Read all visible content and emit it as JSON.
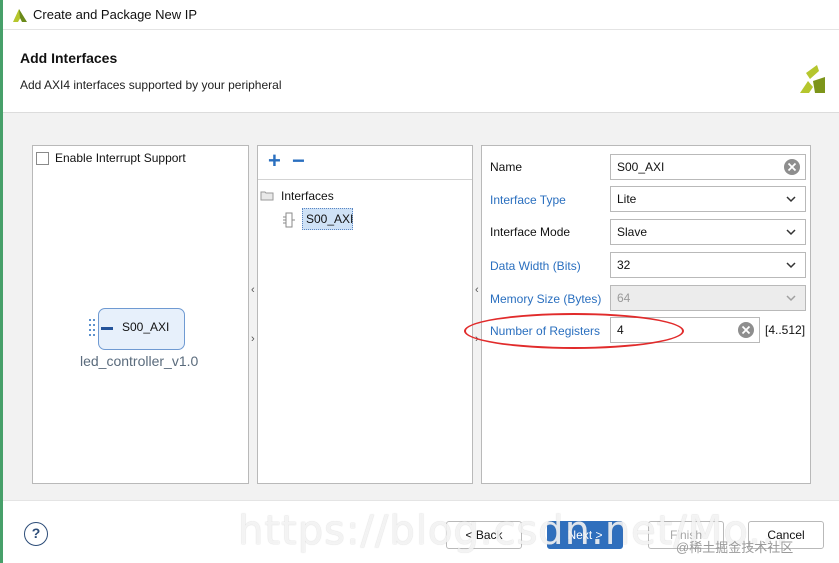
{
  "window": {
    "title": "Create and Package New IP"
  },
  "header": {
    "title": "Add Interfaces",
    "subtitle": "Add AXI4 interfaces supported by your peripheral"
  },
  "left_panel": {
    "interrupt_label": "Enable Interrupt Support",
    "interrupt_checked": false,
    "ip_port_label": "S00_AXI",
    "ip_name": "led_controller_v1.0"
  },
  "middle_panel": {
    "add_icon": "plus-icon",
    "remove_icon": "minus-icon",
    "tree_root": "Interfaces",
    "tree_items": [
      "S00_AXI"
    ]
  },
  "properties": {
    "name": {
      "label": "Name",
      "value": "S00_AXI"
    },
    "interface_type": {
      "label": "Interface Type",
      "value": "Lite"
    },
    "interface_mode": {
      "label": "Interface Mode",
      "value": "Slave"
    },
    "data_width": {
      "label": "Data Width (Bits)",
      "value": "32"
    },
    "memory_size": {
      "label": "Memory Size (Bytes)",
      "value": "64"
    },
    "num_registers": {
      "label": "Number of Registers",
      "value": "4",
      "range": "[4..512]"
    }
  },
  "footer": {
    "help": "?",
    "back": "< Back",
    "next": "Next >",
    "finish": "Finish",
    "cancel": "Cancel"
  },
  "watermark": {
    "url": "https://blog.csdn.net/Mo...",
    "community": "@稀土掘金技术社区"
  },
  "colors": {
    "accent_blue": "#2f6fbd",
    "link_blue": "#2a6fbf",
    "highlight_red": "#e12b2b",
    "brand_green": "#8aa51a"
  }
}
